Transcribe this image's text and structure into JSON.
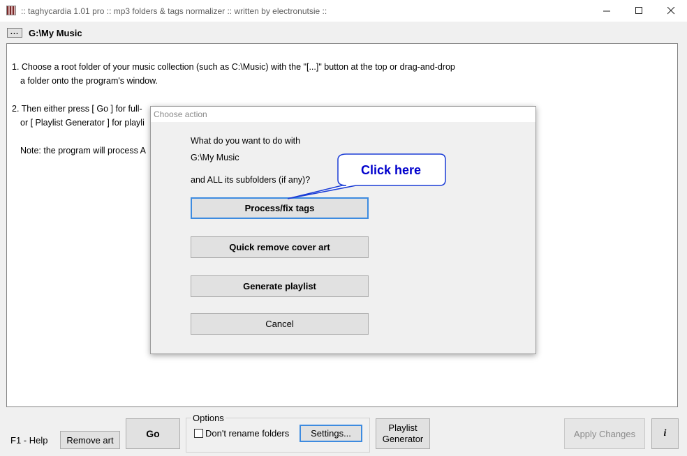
{
  "window": {
    "title": ":: taghycardia 1.01 pro :: mp3 folders & tags normalizer :: written by electronutsie ::"
  },
  "pathbar": {
    "browse_label": "...",
    "path": "G:\\My Music"
  },
  "instructions": {
    "line1": "1. Choose a root folder of your music collection (such as C:\\Music) with the \"[...]\" button at the top or drag-and-drop",
    "line1b": "a folder onto the program's window.",
    "line2": "2. Then either press [ Go ] for full-",
    "line2b": "or [ Playlist Generator ] for playli",
    "note": "Note: the program will process A"
  },
  "dialog": {
    "title": "Choose action",
    "question1": "What do you want to do with",
    "path": "G:\\My Music",
    "question2": "and ALL its subfolders (if any)?",
    "buttons": {
      "process": "Process/fix tags",
      "remove_cover": "Quick remove cover art",
      "playlist": "Generate playlist",
      "cancel": "Cancel"
    }
  },
  "callout": {
    "text": "Click here",
    "color": "#0000cc"
  },
  "bottom": {
    "help": "F1 - Help",
    "remove_art": "Remove art",
    "go": "Go",
    "options_legend": "Options",
    "dont_rename": "Don't rename folders",
    "settings": "Settings...",
    "playlist_line1": "Playlist",
    "playlist_line2": "Generator",
    "apply": "Apply Changes",
    "info": "i"
  }
}
